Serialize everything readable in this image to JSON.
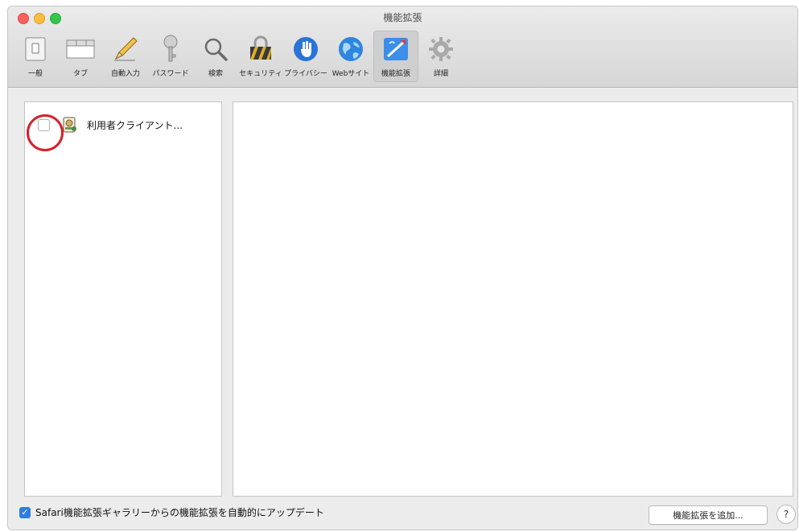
{
  "window": {
    "title": "機能拡張"
  },
  "toolbar": {
    "items": [
      {
        "label": "一般",
        "icon": "general-switch-icon"
      },
      {
        "label": "タブ",
        "icon": "tabs-icon"
      },
      {
        "label": "自動入力",
        "icon": "pencil-icon"
      },
      {
        "label": "パスワード",
        "icon": "key-icon"
      },
      {
        "label": "検索",
        "icon": "magnifier-icon"
      },
      {
        "label": "セキュリティ",
        "icon": "security-lock-icon"
      },
      {
        "label": "プライバシー",
        "icon": "hand-icon"
      },
      {
        "label": "Webサイト",
        "icon": "globe-icon"
      },
      {
        "label": "機能拡張",
        "icon": "puzzle-extension-icon",
        "selected": true
      },
      {
        "label": "詳細",
        "icon": "gear-icon"
      }
    ]
  },
  "extensions": {
    "items": [
      {
        "name": "利用者クライアント...",
        "enabled": false
      }
    ]
  },
  "footer": {
    "auto_update_label": "Safari機能拡張ギャラリーからの機能拡張を自動的にアップデート",
    "auto_update_checked": true,
    "add_button_label": "機能拡張を追加...",
    "help_label": "?"
  },
  "colors": {
    "accent": "#2f7de1",
    "highlight": "#d6202b"
  }
}
